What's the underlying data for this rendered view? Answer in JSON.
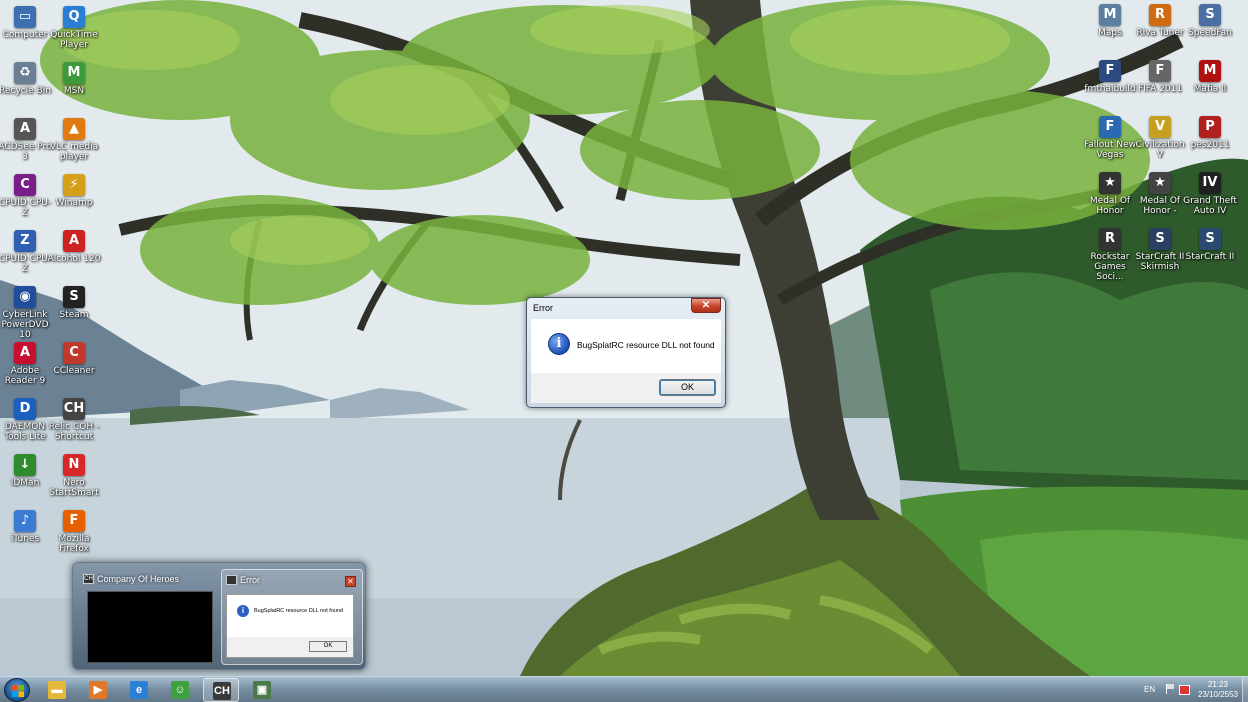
{
  "desktop": {
    "icons_left": [
      {
        "label": "Computer",
        "icon": "computer-icon",
        "color": "#3b6fb0",
        "glyph": "▭"
      },
      {
        "label": "QuickTime Player",
        "icon": "quicktime-icon",
        "color": "#2a7fd4",
        "glyph": "Q"
      },
      {
        "label": "Recycle Bin",
        "icon": "recycle-bin-icon",
        "color": "#6a7f93",
        "glyph": "♻"
      },
      {
        "label": "MSN",
        "icon": "msn-icon",
        "color": "#3c9a3c",
        "glyph": "M"
      },
      {
        "label": "ACDSee Pro 3",
        "icon": "acdsee-icon",
        "color": "#555555",
        "glyph": "A"
      },
      {
        "label": "VLC media player",
        "icon": "vlc-icon",
        "color": "#e07b12",
        "glyph": "▲"
      },
      {
        "label": "CPUID CPU-Z",
        "icon": "cpu-z-icon",
        "color": "#7a1f8a",
        "glyph": "C"
      },
      {
        "label": "Winamp",
        "icon": "winamp-icon",
        "color": "#d4a017",
        "glyph": "⚡"
      },
      {
        "label": "CPUID CPU-Z",
        "icon": "cpu-z-icon",
        "color": "#2f5fb3",
        "glyph": "Z"
      },
      {
        "label": "Alcohol 120",
        "icon": "alcohol-icon",
        "color": "#cc2222",
        "glyph": "A"
      },
      {
        "label": "CyberLink PowerDVD 10",
        "icon": "powerdvd-icon",
        "color": "#1f4f9a",
        "glyph": "◉"
      },
      {
        "label": "Steam",
        "icon": "steam-icon",
        "color": "#222222",
        "glyph": "S"
      },
      {
        "label": "Adobe Reader 9",
        "icon": "adobe-reader-icon",
        "color": "#c8102e",
        "glyph": "A"
      },
      {
        "label": "CCleaner",
        "icon": "ccleaner-icon",
        "color": "#c0392b",
        "glyph": "C"
      },
      {
        "label": "DAEMON Tools Lite",
        "icon": "daemon-tools-icon",
        "color": "#1d5fbf",
        "glyph": "D"
      },
      {
        "label": "Relic COH - Shortcut",
        "icon": "relic-coh-icon",
        "color": "#444444",
        "glyph": "CH"
      },
      {
        "label": "IDMan",
        "icon": "idm-icon",
        "color": "#2e8b2e",
        "glyph": "↓"
      },
      {
        "label": "Nero StartSmart",
        "icon": "nero-icon",
        "color": "#d62828",
        "glyph": "N"
      },
      {
        "label": "iTunes",
        "icon": "itunes-icon",
        "color": "#3a7bd5",
        "glyph": "♪"
      },
      {
        "label": "Mozilla Firefox",
        "icon": "firefox-icon",
        "color": "#e66000",
        "glyph": "F"
      }
    ],
    "icons_right": [
      {
        "label": "Maps",
        "icon": "maps-icon",
        "color": "#5a7fa0",
        "glyph": "M"
      },
      {
        "label": "Riva Tuner",
        "icon": "rivatuner-icon",
        "color": "#d06a10",
        "glyph": "R"
      },
      {
        "label": "SpeedFan",
        "icon": "speedfan-icon",
        "color": "#4a6fa0",
        "glyph": "S"
      },
      {
        "label": "fmthaibuild",
        "icon": "fm-icon",
        "color": "#2a4a80",
        "glyph": "F"
      },
      {
        "label": "FIFA 2011",
        "icon": "fifa-icon",
        "color": "#666666",
        "glyph": "F"
      },
      {
        "label": "Mafia II",
        "icon": "mafia-icon",
        "color": "#b01010",
        "glyph": "M"
      },
      {
        "label": "Fallout New Vegas",
        "icon": "fallout-icon",
        "color": "#2a6ab0",
        "glyph": "F"
      },
      {
        "label": "Civilization V",
        "icon": "civilization-icon",
        "color": "#c8a020",
        "glyph": "V"
      },
      {
        "label": "pes2011",
        "icon": "pes-icon",
        "color": "#b02020",
        "glyph": "P"
      },
      {
        "label": "Medal Of Honor",
        "icon": "medal-of-honor-icon",
        "color": "#333333",
        "glyph": "★"
      },
      {
        "label": "Medal Of Honor -",
        "icon": "medal-of-honor-icon",
        "color": "#444444",
        "glyph": "★"
      },
      {
        "label": "Grand Theft Auto IV",
        "icon": "gta-icon",
        "color": "#202020",
        "glyph": "IV"
      },
      {
        "label": "Rockstar Games Soci...",
        "icon": "rockstar-icon",
        "color": "#333333",
        "glyph": "R"
      },
      {
        "label": "StarCraft II Skirmish",
        "icon": "starcraft-icon",
        "color": "#2a4060",
        "glyph": "S"
      },
      {
        "label": "StarCraft II",
        "icon": "starcraft-icon",
        "color": "#2a4a70",
        "glyph": "S"
      }
    ]
  },
  "error_dialog": {
    "title": "Error",
    "close_glyph": "✕",
    "info_glyph": "i",
    "message": "BugSplatRC resource DLL not found",
    "ok_label": "OK"
  },
  "thumbnail_preview": {
    "coh_title": "Company Of Heroes",
    "coh_icon_glyph": "CH",
    "error_title": "Error",
    "error_close_glyph": "✕",
    "error_message": "BugSplatRC resource DLL not found",
    "error_ok_label": "OK",
    "error_info_glyph": "i"
  },
  "taskbar": {
    "buttons": [
      {
        "name": "explorer",
        "icon": "folder-icon",
        "color": "#e6b83a",
        "glyph": "▬"
      },
      {
        "name": "media-player",
        "icon": "media-player-icon",
        "color": "#e0782a",
        "glyph": "▶"
      },
      {
        "name": "internet-explorer",
        "icon": "internet-explorer-icon",
        "color": "#2b7fd4",
        "glyph": "e"
      },
      {
        "name": "messenger",
        "icon": "messenger-icon",
        "color": "#3fa03f",
        "glyph": "☺"
      },
      {
        "name": "company-of-heroes",
        "icon": "company-of-heroes-icon",
        "color": "#3a3a3a",
        "glyph": "CH",
        "active": true
      },
      {
        "name": "error-window",
        "icon": "error-window-icon",
        "color": "#4a7a4a",
        "glyph": "▣"
      }
    ],
    "language": "EN",
    "time": "21:23",
    "date": "23/10/2553"
  }
}
